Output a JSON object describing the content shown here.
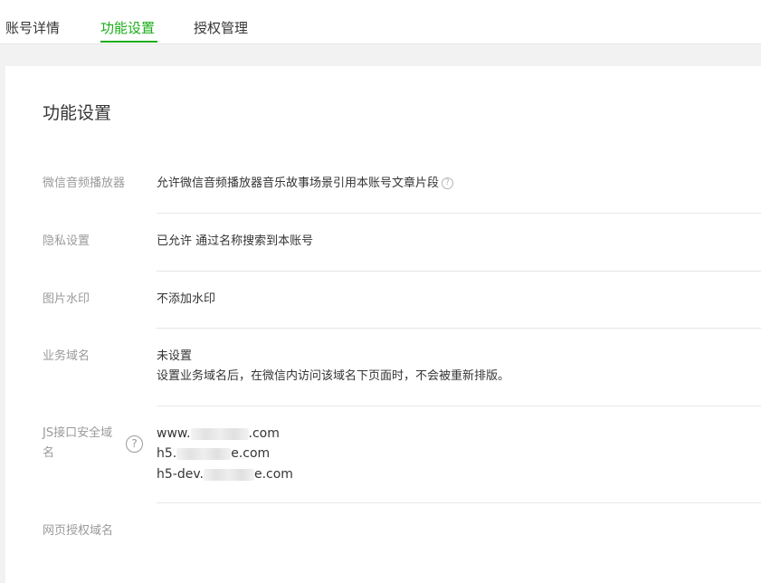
{
  "tabs": [
    {
      "label": "账号详情"
    },
    {
      "label": "功能设置"
    },
    {
      "label": "授权管理"
    }
  ],
  "active_tab_index": 1,
  "accent_color": "#1aad19",
  "panel": {
    "title": "功能设置",
    "rows": {
      "audio_player": {
        "label": "微信音频播放器",
        "value": "允许微信音频播放器音乐故事场景引用本账号文章片段",
        "help_icon": "question-circle-icon"
      },
      "privacy": {
        "label": "隐私设置",
        "value": "已允许 通过名称搜索到本账号"
      },
      "watermark": {
        "label": "图片水印",
        "value": "不添加水印"
      },
      "business_domain": {
        "label": "业务域名",
        "value": "未设置",
        "description": "设置业务域名后，在微信内访问该域名下页面时，不会被重新排版。"
      },
      "js_domain": {
        "label": "JS接口安全域名",
        "help_icon": "question-circle-icon",
        "domains": [
          {
            "prefix": "www.",
            "suffix": ".com"
          },
          {
            "prefix": "h5.",
            "suffix": "e.com"
          },
          {
            "prefix": "h5-dev.",
            "suffix": "e.com"
          }
        ]
      },
      "web_auth_domain": {
        "label": "网页授权域名"
      }
    }
  }
}
